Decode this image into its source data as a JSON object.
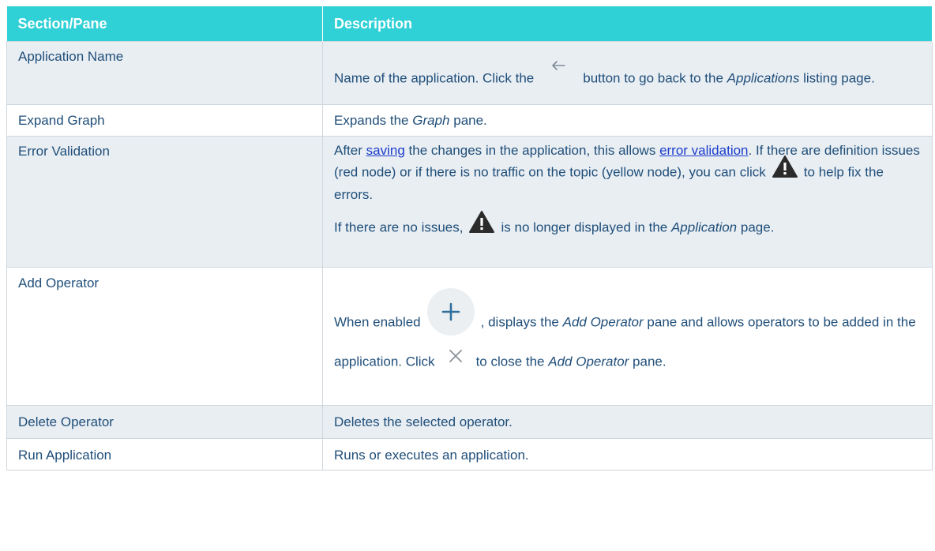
{
  "table": {
    "headers": [
      "Section/Pane",
      "Description"
    ],
    "rows": [
      {
        "section": "Application Name",
        "desc": {
          "t1": "Name of the application. Click the",
          "t2": "button to go back to the",
          "t3": "Applications",
          "t4": "listing page."
        }
      },
      {
        "section": "Expand Graph",
        "desc": {
          "t1": "Expands the",
          "t2": "Graph",
          "t3": "pane."
        }
      },
      {
        "section": "Error Validation",
        "desc": {
          "p1": {
            "t1": "After",
            "link1": "saving",
            "t2": "the changes in the application, this allows",
            "link2": "error validation",
            "t3": ". If there are definition issues (red node) or if there is no traffic on the topic (yellow node), you can click",
            "t4": "to help fix the errors."
          },
          "p2": {
            "t1": "If there are no issues,",
            "t2": "is no longer displayed in the",
            "t3": "Application",
            "t4": "page."
          }
        }
      },
      {
        "section": "Add Operator",
        "desc": {
          "t1": "When enabled",
          "t2": ", displays the",
          "t3": "Add Operator",
          "t4": "pane and allows operators to be added in the application. Click",
          "t5": "to close the",
          "t6": "Add Operator",
          "t7": "pane."
        }
      },
      {
        "section": "Delete Operator",
        "desc": {
          "t1": "Deletes the selected operator."
        }
      },
      {
        "section": "Run Application",
        "desc": {
          "t1": "Runs or executes an application."
        }
      }
    ]
  },
  "icons": {
    "back": "back-arrow-icon",
    "warning": "warning-triangle-icon",
    "add": "add-plus-icon",
    "close": "close-x-icon"
  },
  "colors": {
    "header_bg": "#2fd0d6",
    "header_text": "#ffffff",
    "body_text": "#1f4e79",
    "link": "#1a3ccc",
    "row_shade": "#e9eef3"
  }
}
